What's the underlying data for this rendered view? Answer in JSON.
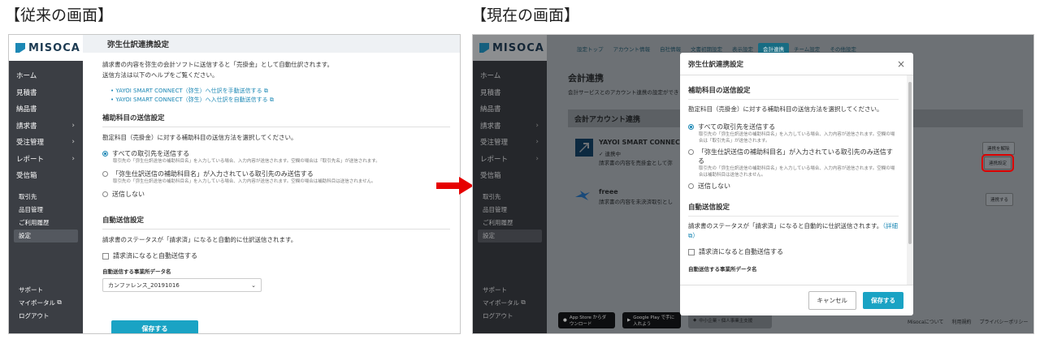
{
  "captions": {
    "old": "【従来の画面】",
    "new": "【現在の画面】"
  },
  "colors": {
    "accent": "#1aa3c4",
    "sidebar": "#3b3e44",
    "highlight": "#d00000",
    "arrow": "#e60000"
  },
  "sidebar": {
    "logo": "MISOCA",
    "items": [
      {
        "label": "ホーム",
        "chev": ""
      },
      {
        "label": "見積書",
        "chev": ""
      },
      {
        "label": "納品書",
        "chev": ""
      },
      {
        "label": "請求書",
        "chev": "›"
      },
      {
        "label": "受注管理",
        "chev": "›"
      },
      {
        "label": "レポート",
        "chev": "›"
      },
      {
        "label": "受信箱",
        "chev": ""
      }
    ],
    "sub": [
      "取引先",
      "品目管理",
      "ご利用履歴",
      "設定"
    ],
    "bottom": [
      "サポート",
      "マイポータル",
      "ログアウト"
    ]
  },
  "old": {
    "title": "弥生仕訳連携設定",
    "desc1": "請求書の内容を弥生の会計ソフトに送信すると「売掛金」として自動仕訳されます。",
    "desc2": "送信方法は以下のヘルプをご覧ください。",
    "link1": "YAYOI SMART CONNECT（弥生）へ仕訳を手動送信する",
    "link2": "YAYOI SMART CONNECT（弥生）へ入仕訳を自動送信する",
    "sec1": "補助科目の送信設定",
    "sec1_desc": "勘定科目（売掛金）に対する補助科目の送信方法を選択してください。",
    "opt1": "すべての取引先を送信する",
    "opt1_hint": "取引先の「弥生仕訳送信の補助科目名」を入力している場合、入力内容が送信されます。空欄の場合は「取引先名」が送信されます。",
    "opt2": "「弥生仕訳送信の補助科目名」が入力されている取引先のみ送信する",
    "opt2_hint": "取引先の「弥生仕訳送信の補助科目名」を入力している場合、入力内容が送信されます。空欄の場合は補助科目は送信されません。",
    "opt3": "送信しない",
    "sec2": "自動送信設定",
    "sec2_desc": "請求書のステータスが「請求済」になると自動的に仕訳送信されます。",
    "auto_chk": "請求済になると自動送信する",
    "dest_label": "自動送信する事業所データ名",
    "dest_value": "カンファレンス_20191016",
    "save": "保存する"
  },
  "new": {
    "tabs": [
      "設定トップ",
      "アカウント情報",
      "自社情報",
      "文書初期設定",
      "表示設定",
      "会計連携",
      "チーム設定",
      "その他設定"
    ],
    "bg_title": "会計連携",
    "bg_desc": "会計サービスとのアカウント連携の設定ができ",
    "bg_card": "会計アカウント連携",
    "yayoi_name": "YAYOI SMART CONNECT",
    "yayoi_status": "✓ 連携中",
    "yayoi_desc": "請求書の内容を売掛金として弥",
    "btn_unlink": "連携を解除",
    "btn_settings": "連携設定",
    "freee_name": "freee",
    "freee_desc": "請求書の内容を未決済取引とし",
    "btn_link": "連携する",
    "store1": "App Store からダウンロード",
    "store2": "Google Play で手に入れよう",
    "store3": "中小企業・個人事業主支援",
    "footer": [
      "Misocaについて",
      "利用規約",
      "プライバシーポリシー"
    ],
    "modal": {
      "title": "弥生仕訳連携設定",
      "close": "×",
      "sec1": "補助科目の送信設定",
      "sec1_desc": "勘定科目（売掛金）に対する補助科目の送信方法を選択してください。",
      "opt1": "すべての取引先を送信する",
      "opt1_hint": "取引先の「弥生仕訳送信の補助科目名」を入力している場合、入力内容が送信されます。空欄の場合は「取引先名」が送信されます。",
      "opt2": "「弥生仕訳送信の補助科目名」が入力されている取引先のみ送信する",
      "opt2_hint": "取引先の「弥生仕訳送信の補助科目名」を入力している場合、入力内容が送信されます。空欄の場合は補助科目は送信されません。",
      "opt3": "送信しない",
      "sec2": "自動送信設定",
      "sec2_desc": "請求書のステータスが「請求済」になると自動的に仕訳送信されます。",
      "detail": "（詳細",
      "auto_chk": "請求済になると自動送信する",
      "dest_label": "自動送信する事業所データ名",
      "cancel": "キャンセル",
      "save": "保存する"
    }
  }
}
